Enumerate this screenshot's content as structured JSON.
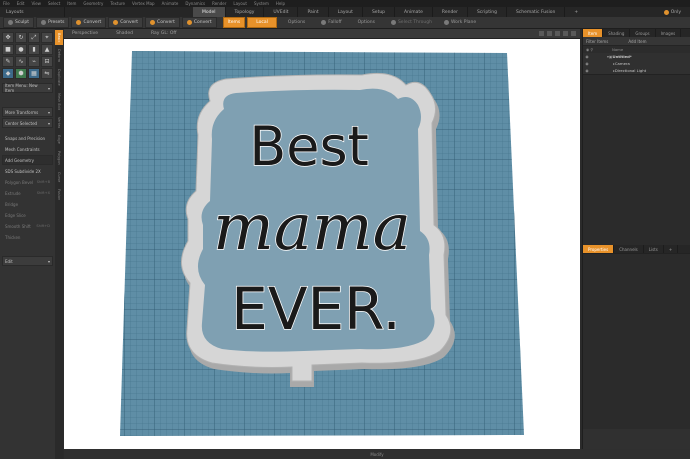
{
  "menubar": {
    "items": [
      "File",
      "Edit",
      "View",
      "Select",
      "Item",
      "Geometry",
      "Texture",
      "Vertex Map",
      "Animate",
      "Dynamics",
      "Render",
      "Layout",
      "System",
      "Help"
    ]
  },
  "tabbar": {
    "app_label": "Layouts",
    "tabs": [
      "Model",
      "Topology",
      "UVEdit",
      "Paint",
      "Layout",
      "Setup",
      "Animate",
      "Render",
      "Scripting",
      "Schematic Fusion"
    ],
    "active_index": 0,
    "add_label": "+",
    "right_label": "Only"
  },
  "toolbar": {
    "sculpt": "Sculpt",
    "presets": "Presets",
    "convert1": "Convert",
    "convert2": "Convert",
    "convert3": "Convert",
    "convert4": "Convert",
    "items": "Items",
    "local": "Local",
    "options1": "Options",
    "falloff": "Falloff",
    "options2": "Options",
    "select_through": "Select Through",
    "work_plane": "Work Plane"
  },
  "left_panel": {
    "item_menu": "Item Menu: New Item",
    "more_transforms": "More Transforms",
    "center_selected": "Center Selected",
    "snaps": "Snaps and Precision",
    "mesh_constraints": "Mesh Constraints",
    "add_geometry": "Add Geometry",
    "subdivide": "SDS Subdivide 2X",
    "greyed": [
      {
        "label": "Polygon Bevel",
        "key": "Shift+B"
      },
      {
        "label": "Extrude",
        "key": "Shift+X"
      },
      {
        "label": "Bridge",
        "key": ""
      },
      {
        "label": "Edge Slice",
        "key": ""
      },
      {
        "label": "Smooth Shift",
        "key": "Shift+D"
      },
      {
        "label": "Thicken",
        "key": ""
      }
    ],
    "edit_dropdown": "Edit"
  },
  "vtabs": [
    "Basic",
    "Deform",
    "Duplicate",
    "Mesh Edit",
    "Vertex",
    "Edge",
    "Polygon",
    "Curve",
    "Fusion"
  ],
  "viewport_header": {
    "view_mode": "Perspective",
    "shading": "Shaded",
    "ray_gl": "Ray GL: Off"
  },
  "viewport_text": {
    "line1": "Best",
    "line2": "mama",
    "line3": "EVER."
  },
  "status": {
    "text": "Modify"
  },
  "right_panel": {
    "top_tabs": [
      "Item",
      "Shading",
      "Groups",
      "Images"
    ],
    "filter_label": "Filter Items",
    "add_item": "Add Item",
    "col_name": "Name",
    "tree": [
      {
        "label": "Untitled*",
        "indent": 0
      },
      {
        "label": "Camera",
        "indent": 1
      },
      {
        "label": "Directional Light",
        "indent": 1
      }
    ],
    "bottom_tabs": [
      "Properties",
      "Channels",
      "Lists",
      "+"
    ]
  },
  "colors": {
    "accent": "#e8922a",
    "grid_bg": "#5f8ea6",
    "cutter": "#d8d8d8"
  }
}
